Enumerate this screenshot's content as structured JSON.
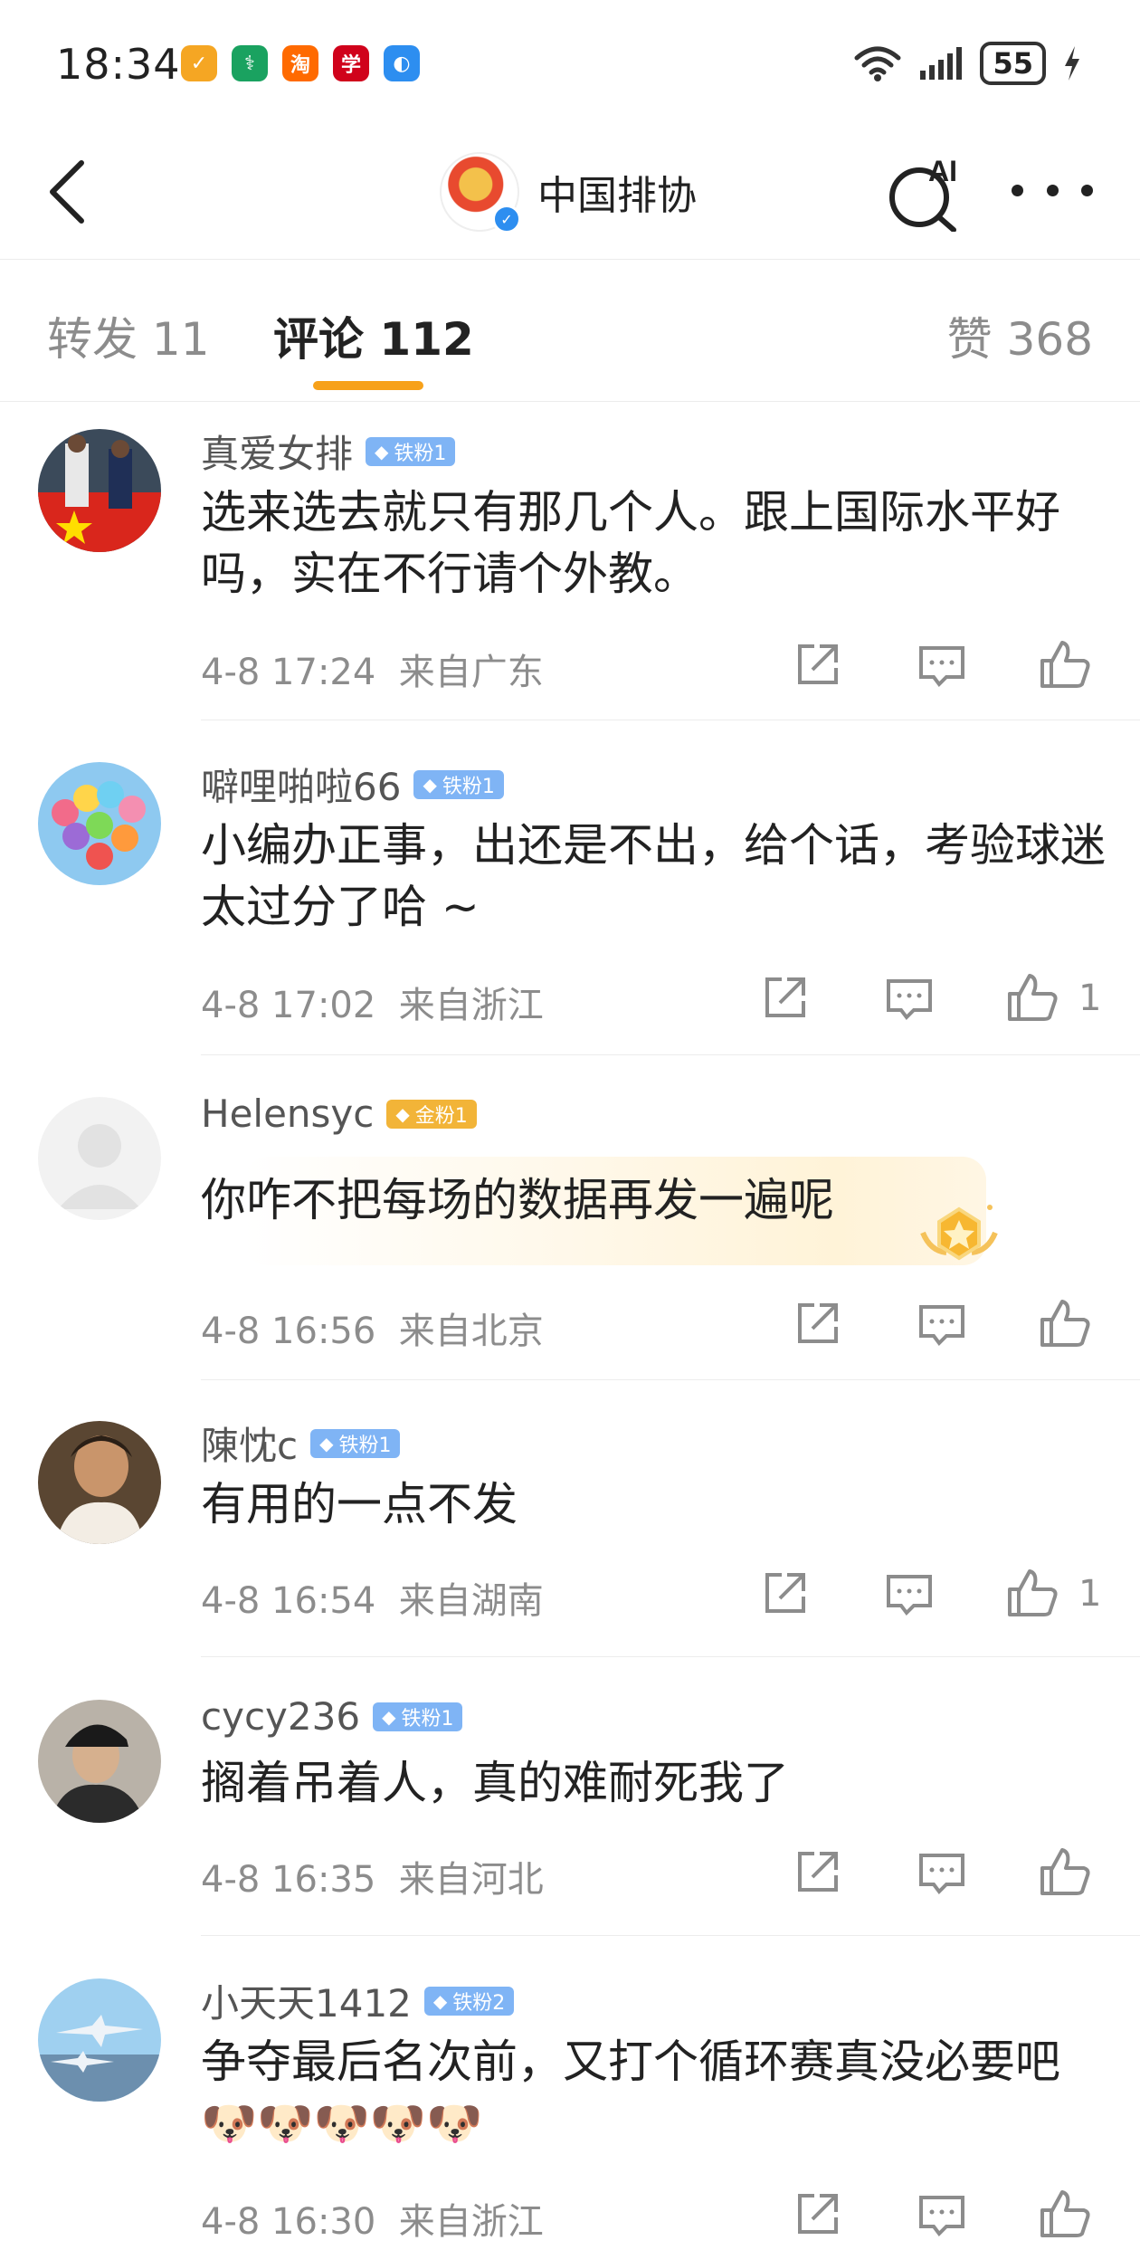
{
  "status_bar": {
    "time": "18:34",
    "app_icons": [
      {
        "name": "app-icon-1",
        "glyph": "✓",
        "color": "#f5a623"
      },
      {
        "name": "app-icon-2",
        "glyph": "⚕",
        "color": "#1aa260"
      },
      {
        "name": "app-icon-taobao",
        "glyph": "淘",
        "color": "#ff6a00"
      },
      {
        "name": "app-icon-xuexi",
        "glyph": "学",
        "color": "#d0021b"
      },
      {
        "name": "app-icon-browser",
        "glyph": "◐",
        "color": "#2d8ef0"
      }
    ],
    "battery": "55"
  },
  "navbar": {
    "account_name": "中国排协",
    "ai_label": "AI"
  },
  "tabs": [
    {
      "label": "转发 11",
      "active": false
    },
    {
      "label": "评论 112",
      "active": true
    },
    {
      "label": "赞 368",
      "active": false
    }
  ],
  "comments": [
    {
      "user": "真爱女排",
      "badge": "铁粉1",
      "badge_type": "iron",
      "text": "选来选去就只有那几个人。跟上国际水平好吗，实在不行请个外教。",
      "time": "4-8 17:24",
      "location": "来自广东",
      "likes": ""
    },
    {
      "user": "噼哩啪啦66",
      "badge": "铁粉1",
      "badge_type": "iron",
      "text": "小编办正事，出还是不出，给个话，考验球迷太过分了哈 ~",
      "time": "4-8 17:02",
      "location": "来自浙江",
      "likes": "1"
    },
    {
      "user": "Helensyc",
      "badge": "金粉1",
      "badge_type": "gold",
      "text": "你咋不把每场的数据再发一遍呢",
      "time": "4-8 16:56",
      "location": "来自北京",
      "likes": ""
    },
    {
      "user": "陳忱c",
      "badge": "铁粉1",
      "badge_type": "iron",
      "text": "有用的一点不发",
      "time": "4-8 16:54",
      "location": "来自湖南",
      "likes": "1"
    },
    {
      "user": "cycy236",
      "badge": "铁粉1",
      "badge_type": "iron",
      "text": "搁着吊着人，真的难耐死我了",
      "time": "4-8 16:35",
      "location": "来自河北",
      "likes": ""
    },
    {
      "user": "小天天1412",
      "badge": "铁粉2",
      "badge_type": "iron",
      "text": "争夺最后名次前，又打个循环赛真没必要吧",
      "emoji": "🐶🐶🐶🐶🐶",
      "time": "4-8 16:30",
      "location": "来自浙江",
      "likes": ""
    }
  ]
}
